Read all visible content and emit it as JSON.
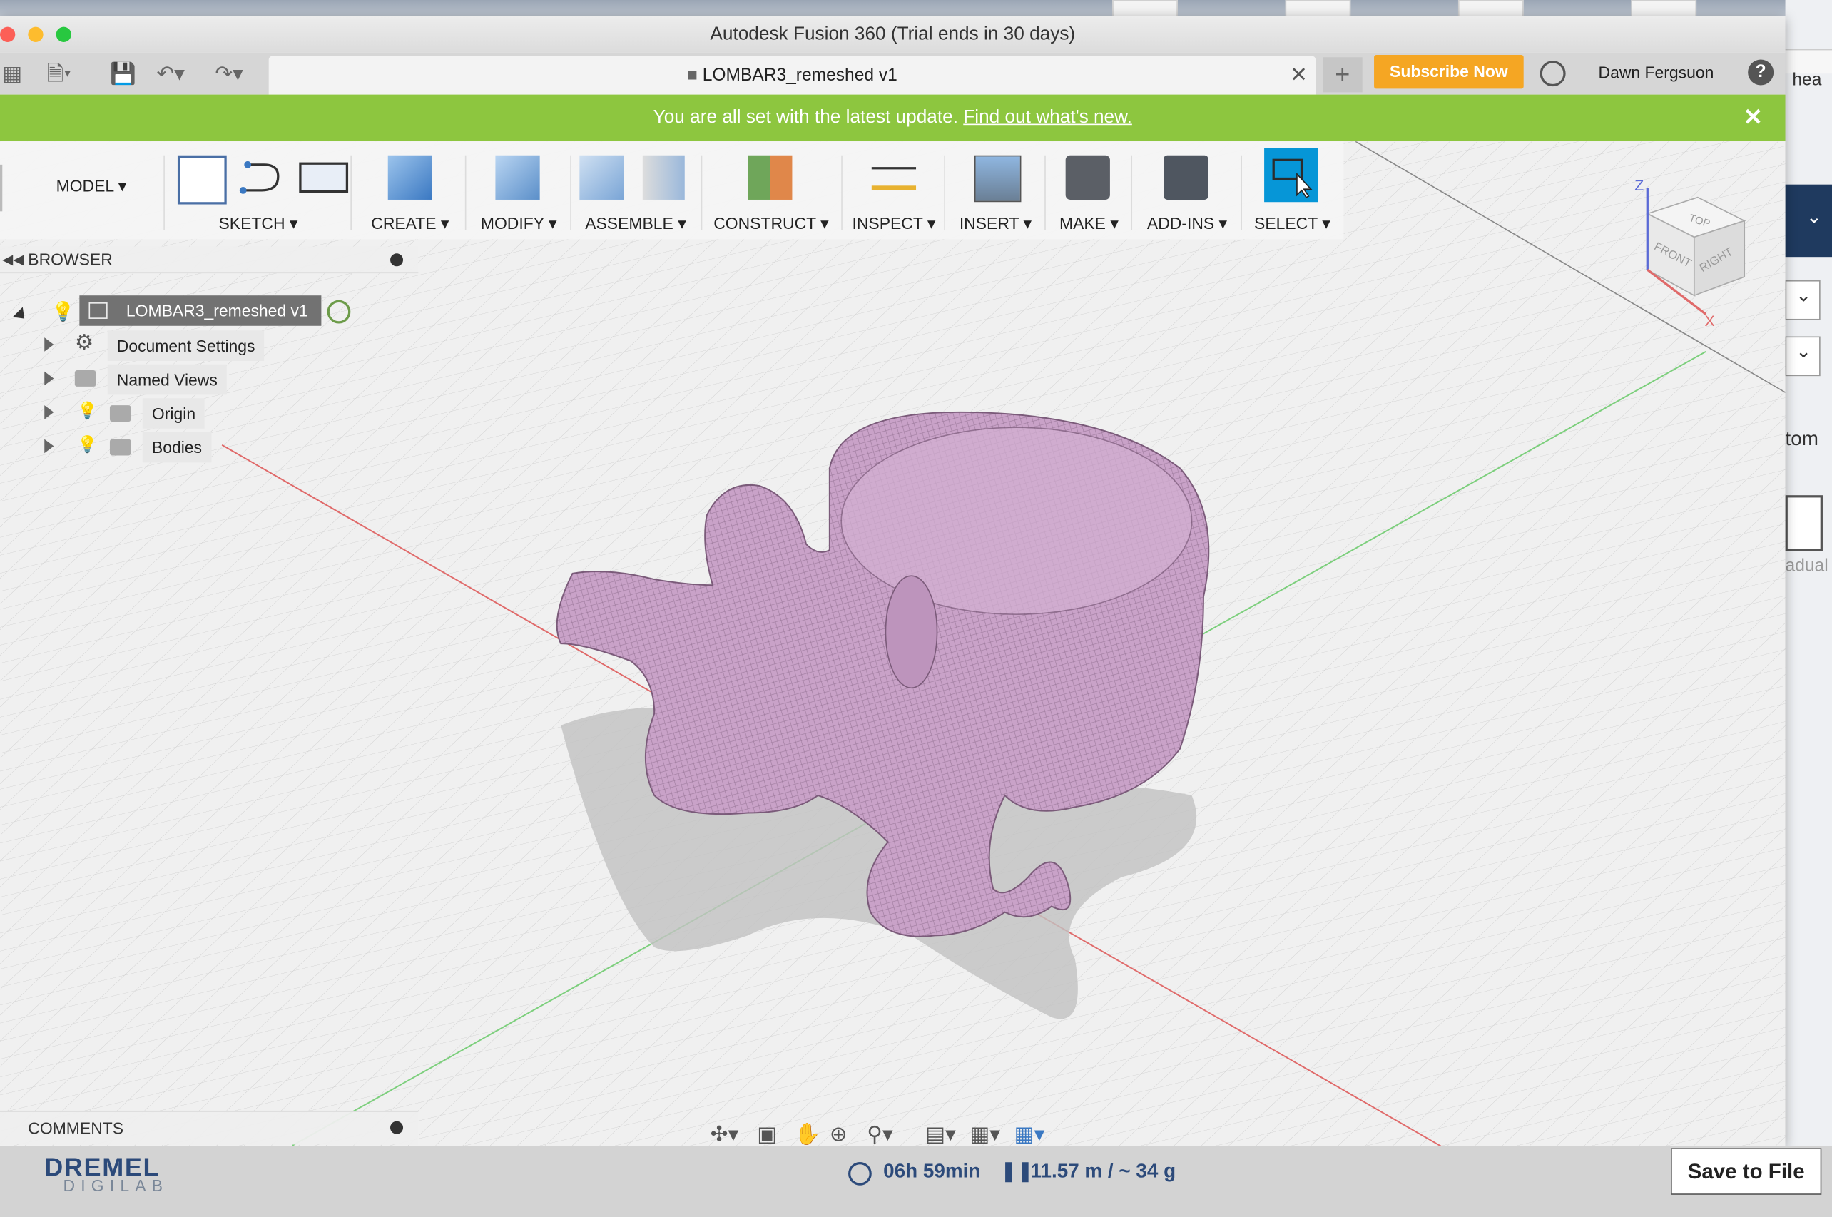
{
  "window": {
    "title": "Autodesk Fusion 360 (Trial ends in 30 days)"
  },
  "tab": {
    "label": "LOMBAR3_remeshed v1",
    "close": "✕",
    "new_tab": "+"
  },
  "account": {
    "subscribe": "Subscribe Now",
    "user": "Dawn Fergsuon",
    "help": "?"
  },
  "banner": {
    "text": "You are all set with the latest update. ",
    "link": "Find out what's new.",
    "close": "✕"
  },
  "toolbar": {
    "model": "MODEL",
    "sketch": "SKETCH",
    "create": "CREATE",
    "modify": "MODIFY",
    "assemble": "ASSEMBLE",
    "construct": "CONSTRUCT",
    "inspect": "INSPECT",
    "insert": "INSERT",
    "make": "MAKE",
    "addins": "ADD-INS",
    "select": "SELECT"
  },
  "browser": {
    "title": "BROWSER",
    "root": "LOMBAR3_remeshed v1",
    "items": [
      "Document Settings",
      "Named Views",
      "Origin",
      "Bodies"
    ]
  },
  "comments": {
    "title": "COMMENTS"
  },
  "viewcube": {
    "top": "TOP",
    "front": "FRONT",
    "right": "RIGHT",
    "z": "Z",
    "x": "X"
  },
  "taskbar": {
    "logo_top": "DREMEL",
    "logo_bottom": "DIGILAB",
    "time": "06h 59min",
    "filament": "11.57 m / ~ 34 g",
    "save": "Save to File"
  },
  "side_panel": {
    "text1": "tom",
    "text2": "adual",
    "text3": "hea"
  },
  "colors": {
    "banner": "#8dc63f",
    "subscribe": "#f5a623",
    "model": "#c9a2c8",
    "select_active": "#0696d7"
  }
}
